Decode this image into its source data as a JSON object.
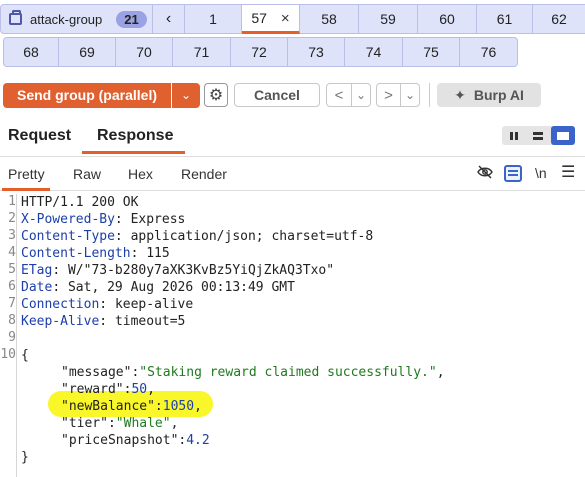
{
  "tab_strip": {
    "group_name": "attack-group",
    "group_count": "21",
    "prev_arrow": "‹",
    "row1_tabs": [
      "1",
      "57",
      "58",
      "59",
      "60",
      "61",
      "62"
    ],
    "active_tab": "57",
    "close_symbol": "×",
    "row2_tabs": [
      "68",
      "69",
      "70",
      "71",
      "72",
      "73",
      "74",
      "75",
      "76"
    ]
  },
  "toolbar": {
    "send_label": "Send group (parallel)",
    "dropdown_symbol": "⌄",
    "settings_icon": "gear-icon",
    "cancel_label": "Cancel",
    "back_symbol": "<",
    "back_dd_symbol": "⌄",
    "forward_symbol": ">",
    "forward_dd_symbol": "⌄",
    "burp_ai_label": "Burp AI"
  },
  "panel_tabs": {
    "request": "Request",
    "response": "Response",
    "active": "Response"
  },
  "view_tabs": {
    "pretty": "Pretty",
    "raw": "Raw",
    "hex": "Hex",
    "render": "Render",
    "newline_toggle": "\\n",
    "active": "Pretty"
  },
  "response": {
    "line_numbers": [
      "1",
      "2",
      "3",
      "4",
      "5",
      "6",
      "7",
      "8",
      "9",
      "10",
      "",
      "",
      "",
      "",
      "",
      ""
    ],
    "status_line": "HTTP/1.1 200 OK",
    "headers": [
      {
        "name": "X-Powered-By",
        "value": "Express"
      },
      {
        "name": "Content-Type",
        "value": "application/json; charset=utf-8"
      },
      {
        "name": "Content-Length",
        "value": "115"
      },
      {
        "name": "ETag",
        "value": "W/\"73-b280y7aXK3KvBz5YiQjZkAQ3Txo\""
      },
      {
        "name": "Date",
        "value": "Sat, 29 Aug 2026 00:13:49 GMT"
      },
      {
        "name": "Connection",
        "value": "keep-alive"
      },
      {
        "name": "Keep-Alive",
        "value": "timeout=5"
      }
    ],
    "body_open": "{",
    "body_close": "}",
    "body": [
      {
        "key": "\"message\"",
        "value": "\"Staking reward claimed successfully.\"",
        "type": "string",
        "trail": ","
      },
      {
        "key": "\"reward\"",
        "value": "50",
        "type": "number",
        "trail": ","
      },
      {
        "key": "\"newBalance\"",
        "value": "1050",
        "type": "number",
        "trail": ","
      },
      {
        "key": "\"tier\"",
        "value": "\"Whale\"",
        "type": "string",
        "trail": ","
      },
      {
        "key": "\"priceSnapshot\"",
        "value": "4.2",
        "type": "number",
        "trail": ""
      }
    ],
    "highlighted_key": "\"newBalance\"",
    "highlight_color": "#f9f72a"
  },
  "colors": {
    "accent": "#e0602f",
    "tab_bg": "#dfe3fa",
    "header_name": "#1c3fa8",
    "json_string": "#1f7a1f"
  }
}
